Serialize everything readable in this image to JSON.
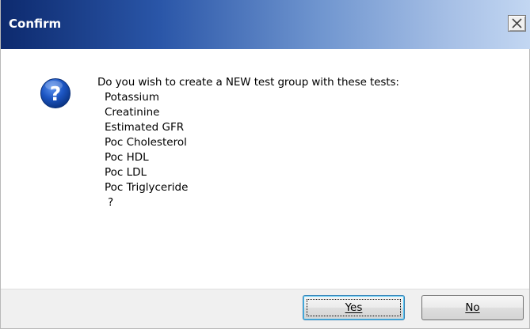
{
  "window": {
    "title": "Confirm"
  },
  "dialog": {
    "icon": "question-icon",
    "message": "Do you wish to create a NEW test group with these tests:",
    "tests": [
      "Potassium",
      "Creatinine",
      "Estimated GFR",
      "Poc Cholesterol",
      "Poc HDL",
      "Poc LDL",
      "Poc Triglyceride"
    ],
    "suffix": "?"
  },
  "buttons": {
    "yes_label": "Yes",
    "no_label": "No"
  },
  "colors": {
    "titlebar_start": "#0d2a6e",
    "titlebar_end": "#c3d7f2",
    "icon_blue": "#1c55c2",
    "footer_bg": "#f0f0f0"
  }
}
